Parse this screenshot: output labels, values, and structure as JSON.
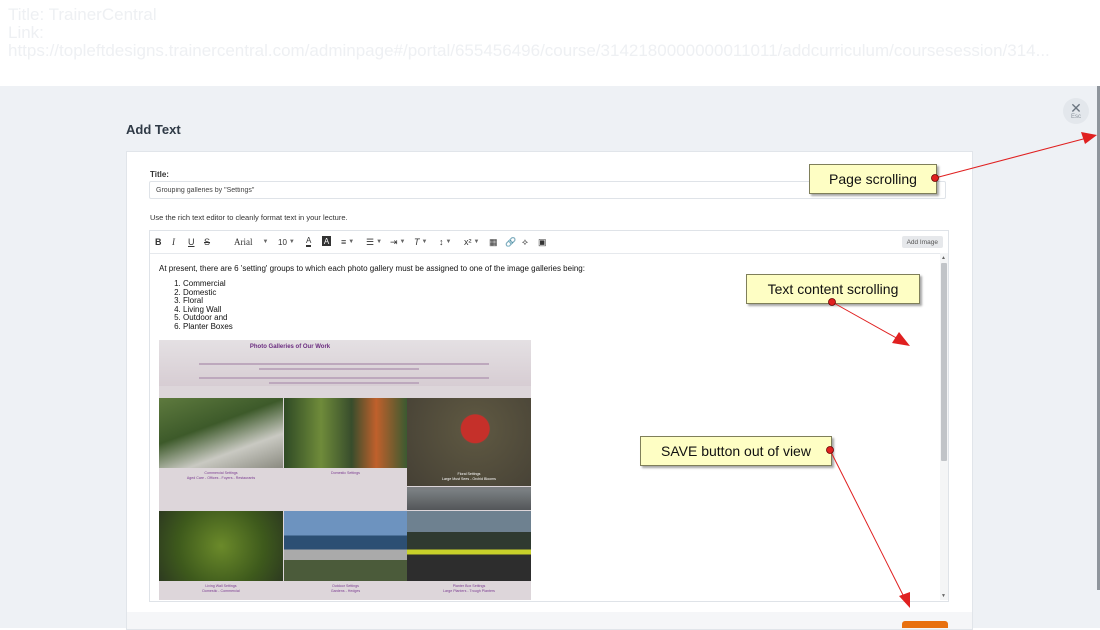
{
  "browser_meta": {
    "title_line": "Title: TrainerCentral",
    "links_label": "Link:",
    "url": "https://topleftdesigns.trainercentral.com/adminpage#/portal/655456496/course/3142180000000011011/addcurriculum/coursesession/314..."
  },
  "modal": {
    "heading": "Add Text",
    "close_label": "Esc",
    "title_label": "Title:",
    "title_value": "Grouping galleries by \"Settings\"",
    "helper_text": "Use the rich text editor to cleanly format text in your lecture.",
    "toolbar": {
      "font_family": "Arial",
      "font_size": "10",
      "add_image_label": "Add Image"
    },
    "content": {
      "intro": "At present, there are 6 'setting' groups to which each photo gallery must be assigned to one of the image galleries being:",
      "list": [
        "Commercial",
        "Domestic",
        "Floral",
        "Living Wall",
        "Outdoor and",
        "Planter Boxes"
      ]
    },
    "gallery_image": {
      "heading": "Photo Galleries of Our Work",
      "captions": [
        "Commercial Settings",
        "Aged Care - Offices - Foyers - Restaurants",
        "Domestic Settings",
        "Floral Settings",
        "Large Must Sees - Orchid Blooms",
        "Living Wall Settings",
        "Domestic - Commercial",
        "Outdoor Settings",
        "Gardens - Hedges",
        "Planter Box Settings",
        "Large Planters - Trough Planters"
      ]
    }
  },
  "annotations": {
    "page_scrolling": "Page scrolling",
    "text_content_scrolling": "Text content scrolling",
    "save_out_of_view": "SAVE button out of view"
  },
  "colors": {
    "save_accent": "#e8700f",
    "callout_fill": "#fefec4",
    "arrow": "#e02020"
  }
}
